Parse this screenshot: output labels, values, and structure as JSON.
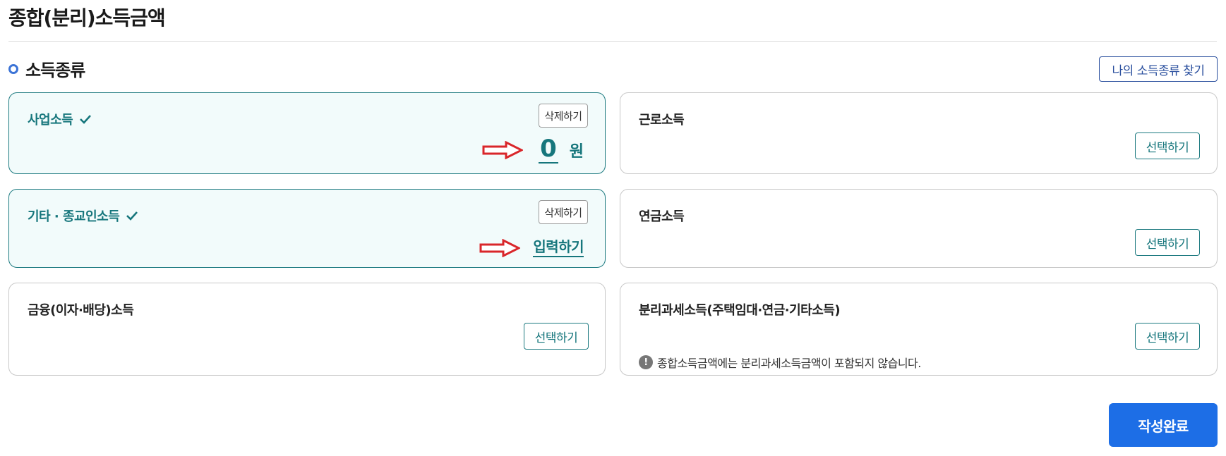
{
  "page": {
    "title": "종합(분리)소득금액"
  },
  "section": {
    "title": "소득종류",
    "find_button": "나의 소득종류 찾기"
  },
  "cards": {
    "business": {
      "label": "사업소득",
      "delete_label": "삭제하기",
      "amount": "0",
      "unit": "원"
    },
    "other_religious": {
      "label": "기타 · 종교인소득",
      "delete_label": "삭제하기",
      "input_label": "입력하기"
    },
    "financial": {
      "label": "금융(이자·배당)소득",
      "select_label": "선택하기"
    },
    "wage": {
      "label": "근로소득",
      "select_label": "선택하기"
    },
    "pension": {
      "label": "연금소득",
      "select_label": "선택하기"
    },
    "separate_tax": {
      "label": "분리과세소득(주택임대·연금·기타소득)",
      "select_label": "선택하기",
      "notice": "종합소득금액에는 분리과세소득금액이 포함되지 않습니다."
    }
  },
  "footer": {
    "complete_label": "작성완료"
  },
  "colors": {
    "accent": "#16767c",
    "primary_button": "#1d6ee6",
    "arrow": "#d9262a",
    "bullet": "#3b73d6"
  }
}
